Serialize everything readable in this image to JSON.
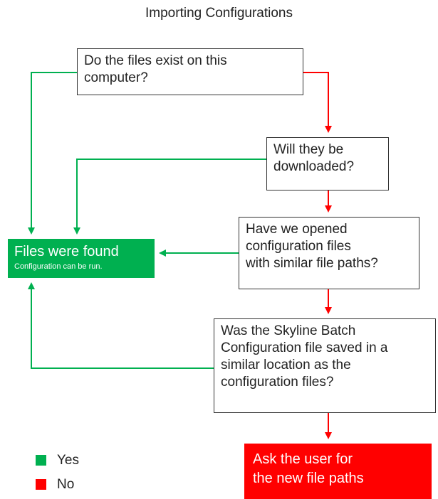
{
  "title": "Importing Configurations",
  "nodes": {
    "q1": "Do the files exist on this\ncomputer?",
    "q2": "Will they be\ndownloaded?",
    "q3": "Have we opened\nconfiguration files\nwith similar file paths?",
    "q4": "Was the Skyline Batch\nConfiguration file saved in a\nsimilar location as the\nconfiguration files?"
  },
  "found": {
    "title": "Files were found",
    "subtitle": "Configuration can be run."
  },
  "ask": "Ask the user for\nthe new file paths",
  "legend": [
    {
      "label": "Yes",
      "color": "#00b050"
    },
    {
      "label": "No",
      "color": "#ff0000"
    }
  ],
  "colors": {
    "yes": "#00b050",
    "no": "#ff0000"
  }
}
